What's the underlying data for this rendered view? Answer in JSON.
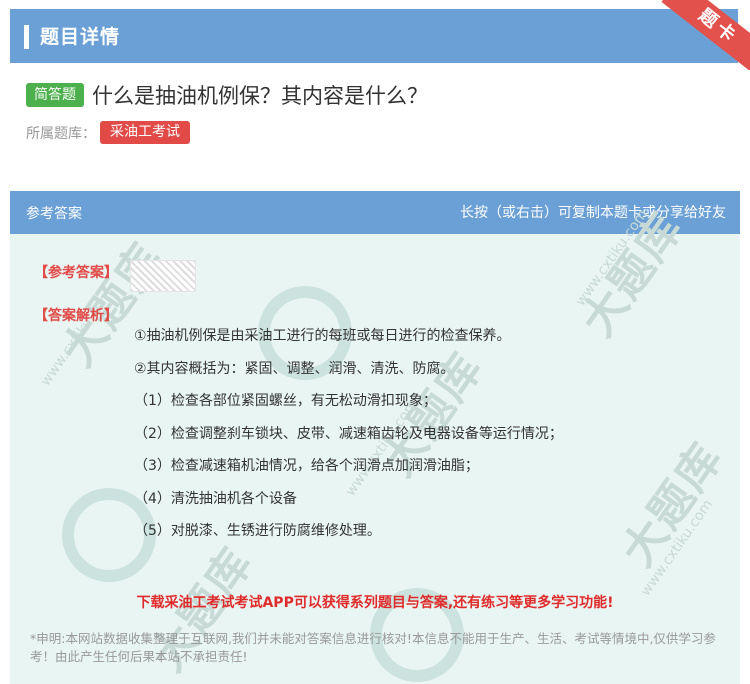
{
  "header": {
    "title": "题目详情"
  },
  "corner_badge": {
    "label": "题卡"
  },
  "question": {
    "type_tag": "简答题",
    "text": "什么是抽油机例保？其内容是什么？",
    "source_label": "所属题库：",
    "source_name": "采油工考试"
  },
  "answer_section": {
    "header_left": "参考答案",
    "header_right": "长按（或右击）可复制本题卡或分享给好友",
    "answer_label": "【参考答案】",
    "analysis_label": "【答案解析】",
    "analysis_lines": [
      "①抽油机例保是由采油工进行的每班或每日进行的检查保养。",
      "②其内容概括为：紧固、调整、润滑、清洗、防腐。",
      "（1）检查各部位紧固螺丝，有无松动滑扣现象；",
      "（2）检查调整刹车锁块、皮带、减速箱齿轮及电器设备等运行情况；",
      "（3）检查减速箱机油情况，给各个润滑点加润滑油脂；",
      "（4）清洗抽油机各个设备",
      "（5）对脱漆、生锈进行防腐维修处理。"
    ],
    "promo_text": "下载采油工考试考试APP可以获得系列题目与答案,还有练习等更多学习功能!",
    "disclaimer": "*申明:本网站数据收集整理于互联网,我们并未能对答案信息进行核对!本信息不能用于生产、生活、考试等情境中,仅供学习参考！由此产生任何后果本站不承担责任!"
  },
  "watermark": {
    "text": "大题库",
    "site": "www.cxtiku.com"
  },
  "colors": {
    "header_blue": "#6aa0d6",
    "tag_green": "#4cb04c",
    "chip_red": "#e14a47",
    "card_bg": "#e9f5f3",
    "promo_red": "#e02b2b"
  }
}
